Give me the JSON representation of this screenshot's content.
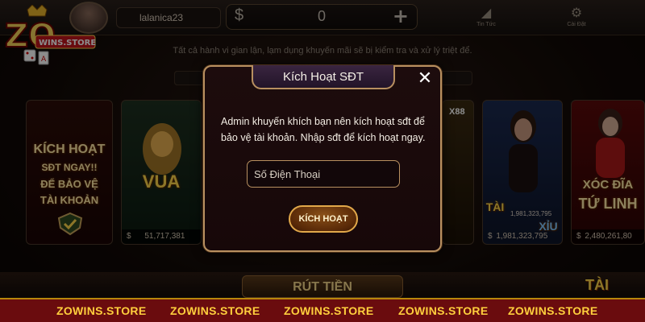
{
  "topbar": {
    "username": "lalanica23",
    "balance": "0",
    "news_label": "Tin Tức",
    "settings_label": "Cài Đặt"
  },
  "warning_text": "Tất cả hành vi gian lận, lạm dụng khuyến mãi sẽ bị kiểm tra và xử lý triệt để.",
  "games": {
    "promo_lines": [
      "KÍCH HOẠT",
      "SĐT NGAY!!",
      "ĐỂ BẢO VỆ",
      "TÀI KHOẢN"
    ],
    "promo_jackpot": "",
    "vua_title": "VUA",
    "vua_jackpot": "51,717,381",
    "xx88_label": "X88",
    "taixiu_tai": "TÀI",
    "taixiu_xiu": "XỈU",
    "taixiu_jackpot_top": "1,981,323,795",
    "taixiu_jackpot": "1,981,323,795",
    "xocdia_title": "XÓC ĐĨA",
    "xocdia_subtitle": "TỨ LINH",
    "xocdia_jackpot": "2,480,261,80"
  },
  "bottom": {
    "withdraw_label": "RÚT TIỀN",
    "tai_badge": "TÀI"
  },
  "logo": {
    "text": "ZO",
    "subtext": "WINS.STORE"
  },
  "watermark": [
    "ZOWINS.STORE",
    "ZOWINS.STORE",
    "ZOWINS.STORE",
    "ZOWINS.STORE",
    "ZOWINS.STORE"
  ],
  "dialog": {
    "title": "Kích Hoạt SĐT",
    "body_line1": "Admin khuyến khích bạn nên kích hoạt sđt để",
    "body_line2": "bảo vệ tài khoản. Nhập sđt để kích hoạt ngay.",
    "phone_placeholder": "Số Điện Thoại",
    "phone_value": "",
    "activate_label": "KÍCH HOẠT"
  },
  "colors": {
    "accent_gold": "#b89060",
    "watermark_bg": "#6a0c0e",
    "watermark_text": "#ffcf3d"
  }
}
